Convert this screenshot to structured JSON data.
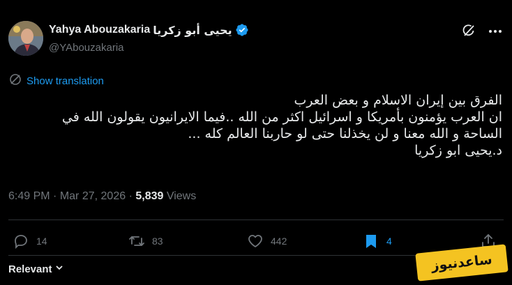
{
  "author": {
    "name": "Yahya Abouzakaria",
    "name_arabic": "يحيى أبو زكريا",
    "handle": "@YAbouzakaria",
    "verified": true
  },
  "translate_label": "Show translation",
  "tweet_lines": [
    "الفرق بين إيران الاسلام و بعض العرب",
    "ان العرب يؤمنون بأمريكا و اسرائيل اكثر من الله ..فيما الايرانيون يقولون الله في",
    "الساحة و الله معنا و لن يخذلنا حتى لو حاربنا العالم كله ...",
    "د.يحيى ابو زكريا"
  ],
  "meta": {
    "time": "6:49 PM",
    "separator": "·",
    "date": "Mar 27, 2026",
    "views_count": "5,839",
    "views_label": "Views"
  },
  "actions": {
    "replies": "14",
    "reposts": "83",
    "likes": "442",
    "bookmarks": "4"
  },
  "relevant_label": "Relevant",
  "watermark_text": "ساعدنیوز",
  "colors": {
    "background": "#000000",
    "accent": "#1d9bf0",
    "muted": "#71767b",
    "text": "#e7e9ea",
    "watermark": "#f4c321"
  }
}
